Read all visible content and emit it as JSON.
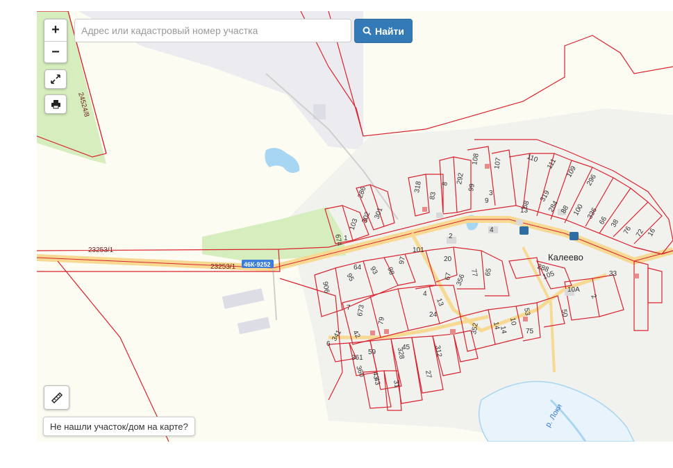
{
  "search": {
    "placeholder": "Адрес или кадастровый номер участка",
    "button_label": "Найти"
  },
  "controls": {
    "zoom_in": "+",
    "zoom_out": "−"
  },
  "not_found_label": "Не нашли участок/дом на карте?",
  "map": {
    "village_name": "Калеево",
    "road_number": "46К-9252",
    "road_parcel_left": "23253/1",
    "road_parcel_right": "23253/1",
    "field_parcel": "24524/8",
    "river_label": "р. Локи",
    "plot_numbers": [
      "110",
      "111",
      "109",
      "296",
      "107",
      "108",
      "292",
      "8",
      "318",
      "83",
      "99",
      "3",
      "9",
      "319",
      "284",
      "88",
      "100",
      "336",
      "66",
      "38",
      "76",
      "72",
      "16",
      "68",
      "13",
      "286",
      "301",
      "302",
      "103",
      "674",
      "1",
      "2",
      "101",
      "4",
      "288",
      "105",
      "93",
      "98",
      "97",
      "95",
      "906",
      "64",
      "4",
      "20",
      "77",
      "65",
      "67",
      "356",
      "13",
      "7",
      "673",
      "79",
      "42",
      "24",
      "352",
      "14",
      "10",
      "53",
      "50",
      "2",
      "33",
      "10А",
      "75",
      "45",
      "43",
      "14",
      "341",
      "6",
      "59",
      "361",
      "360",
      "43",
      "328",
      "312",
      "27",
      "31"
    ],
    "colors": {
      "parcel_line": "#d9232e",
      "road_fill": "#f8d992",
      "green_area": "#d6eebd",
      "water": "#a7d6f2",
      "village_area": "#f1f1ee",
      "background": "#fdfcf2"
    }
  }
}
